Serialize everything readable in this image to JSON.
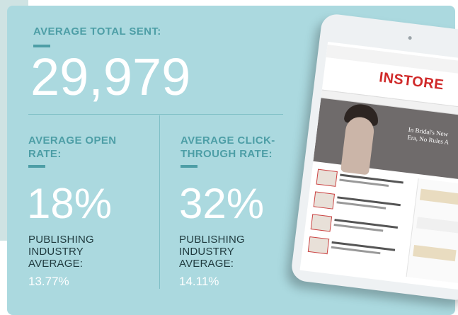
{
  "metrics": {
    "total_sent": {
      "label": "AVERAGE TOTAL SENT:",
      "value": "29,979"
    },
    "open_rate": {
      "label_line1": "AVERAGE OPEN",
      "label_line2": "RATE:",
      "value": "18%",
      "sub_line1": "PUBLISHING",
      "sub_line2": "INDUSTRY",
      "sub_line3": "AVERAGE:",
      "sub_value": "13.77%"
    },
    "click_rate": {
      "label_line1": "AVERAGE CLICK-",
      "label_line2": "THROUGH RATE:",
      "value": "32%",
      "sub_line1": "PUBLISHING",
      "sub_line2": "INDUSTRY",
      "sub_line3": "AVERAGE:",
      "sub_value": "14.11%"
    }
  },
  "tablet": {
    "site_logo": "INSTORE",
    "hero_line1": "In Bridal's New",
    "hero_line2": "Era, No Rules A"
  },
  "colors": {
    "card_bg": "#abd9df",
    "accent": "#4d9ea6",
    "value_text": "#ffffff"
  }
}
